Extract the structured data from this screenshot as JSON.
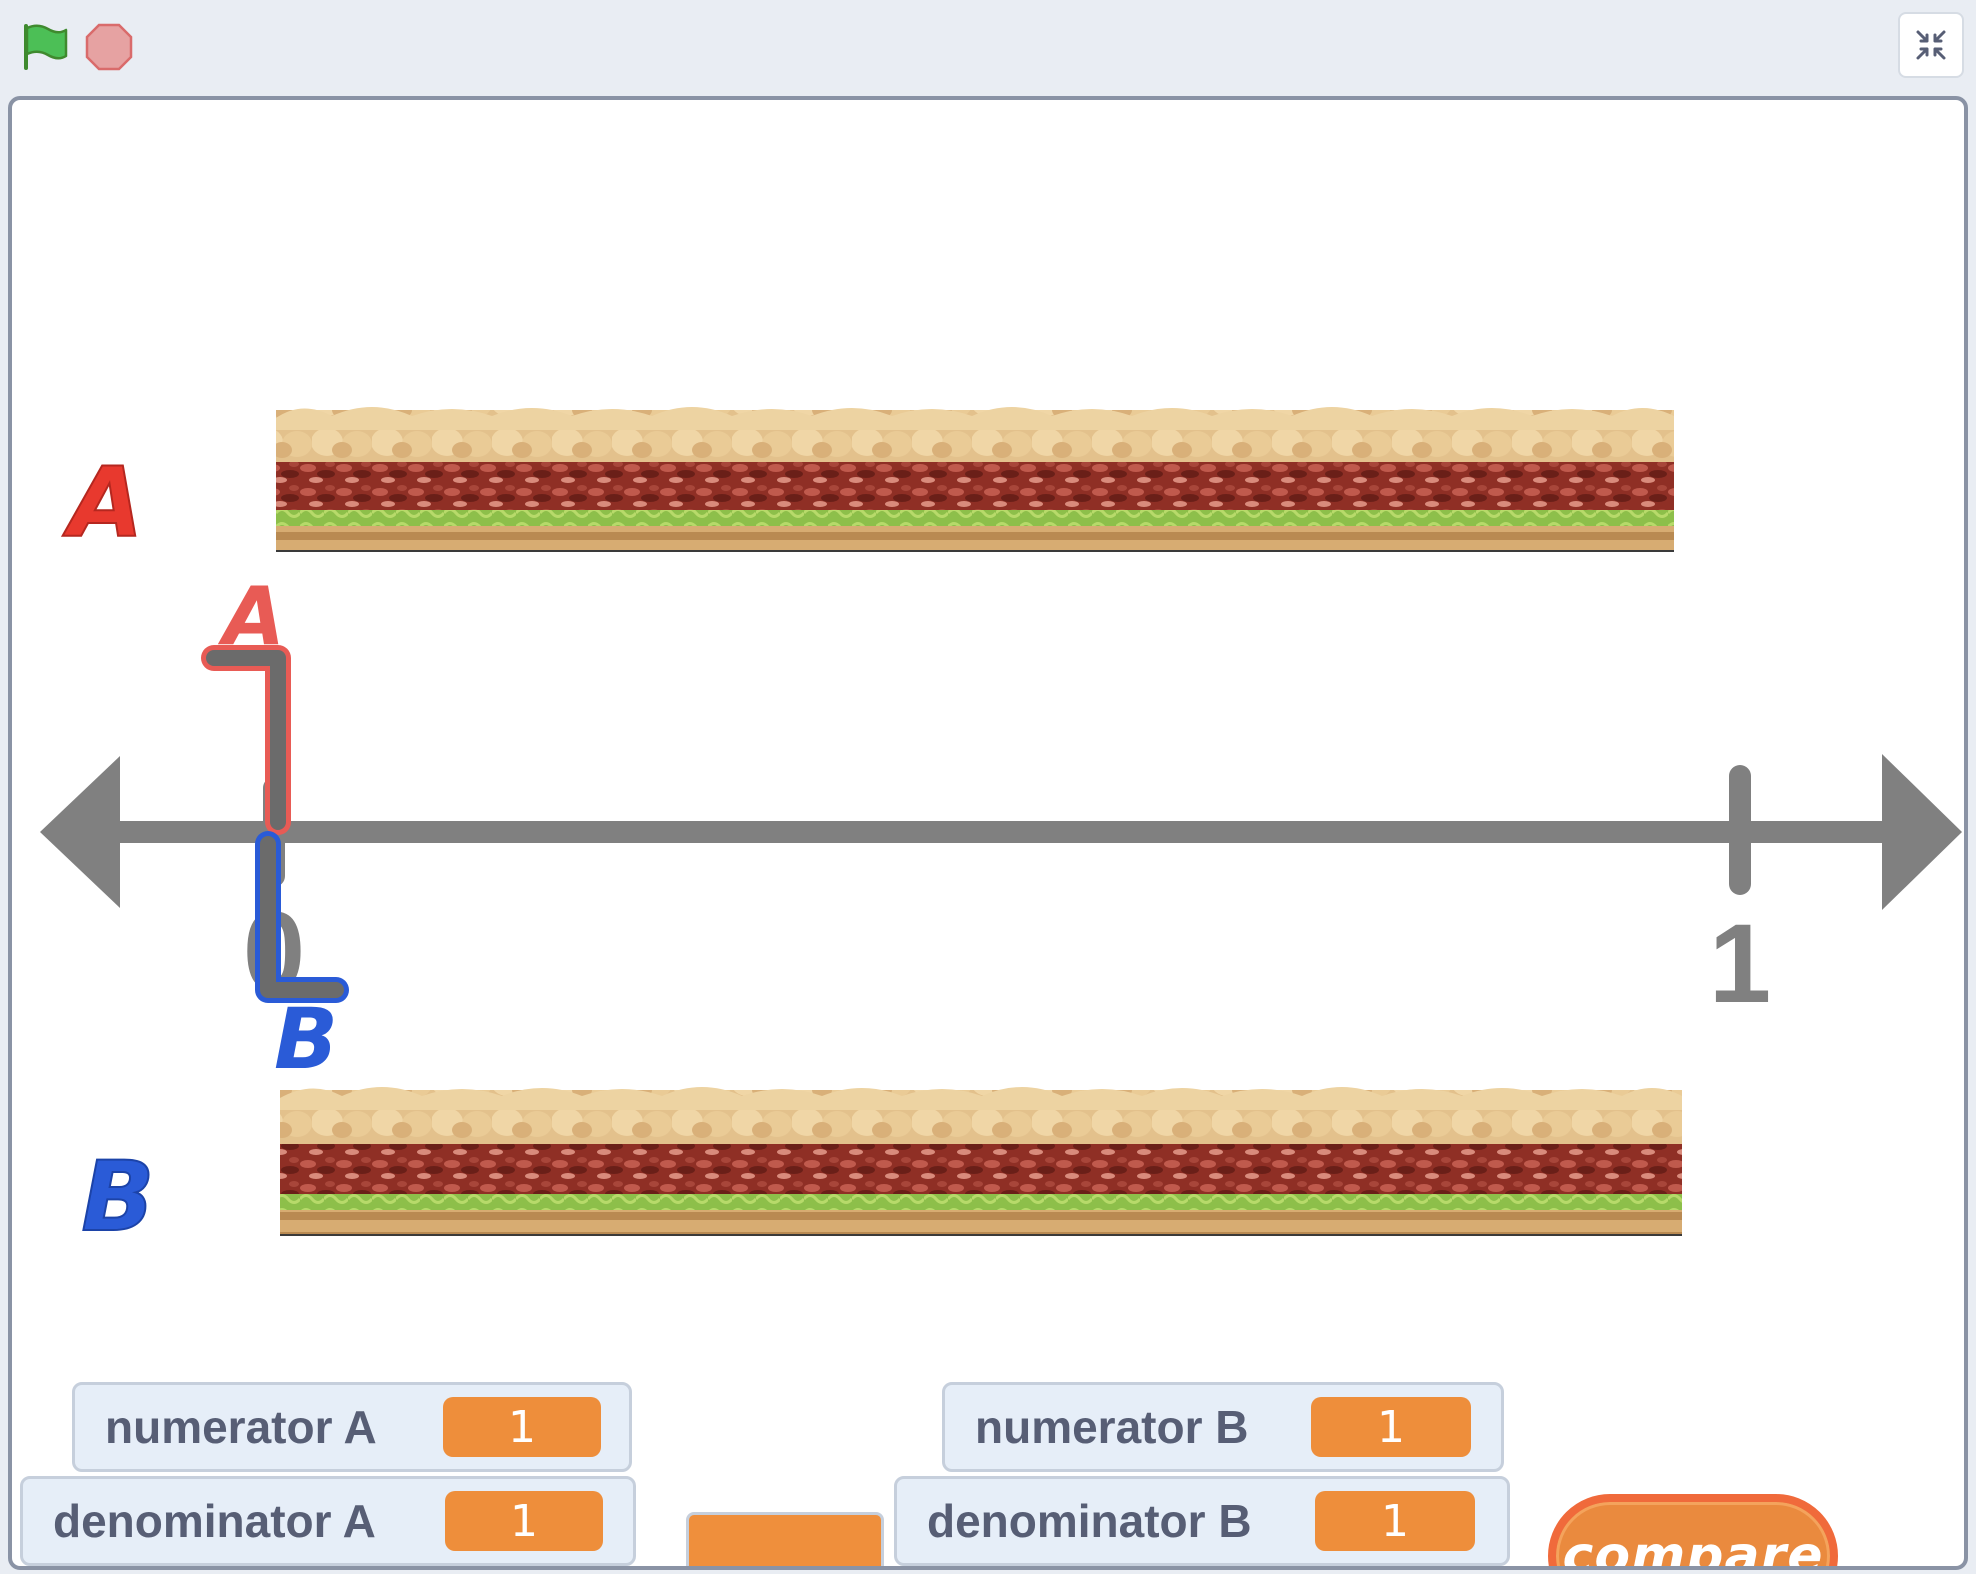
{
  "toolbar": {
    "green_flag_icon": "green-flag-icon",
    "stop_icon": "stop-sign-icon",
    "fullscreen_icon": "exit-fullscreen-icon"
  },
  "stage": {
    "label_a": "A",
    "label_b": "B",
    "marker_a_label": "A",
    "marker_b_label": "B",
    "number_line": {
      "tick_0": "0",
      "tick_1": "1"
    }
  },
  "monitors": {
    "numerator_a": {
      "label": "numerator A",
      "value": "1"
    },
    "denominator_a": {
      "label": "denominator A",
      "value": "1"
    },
    "numerator_b": {
      "label": "numerator B",
      "value": "1"
    },
    "denominator_b": {
      "label": "denominator B",
      "value": "1"
    }
  },
  "compare_button": {
    "label": "compare"
  },
  "colors": {
    "accent_orange": "#ee8e3b",
    "label_a_red": "#e8392e",
    "label_b_blue": "#2a5bd7",
    "number_line_gray": "#808080"
  }
}
